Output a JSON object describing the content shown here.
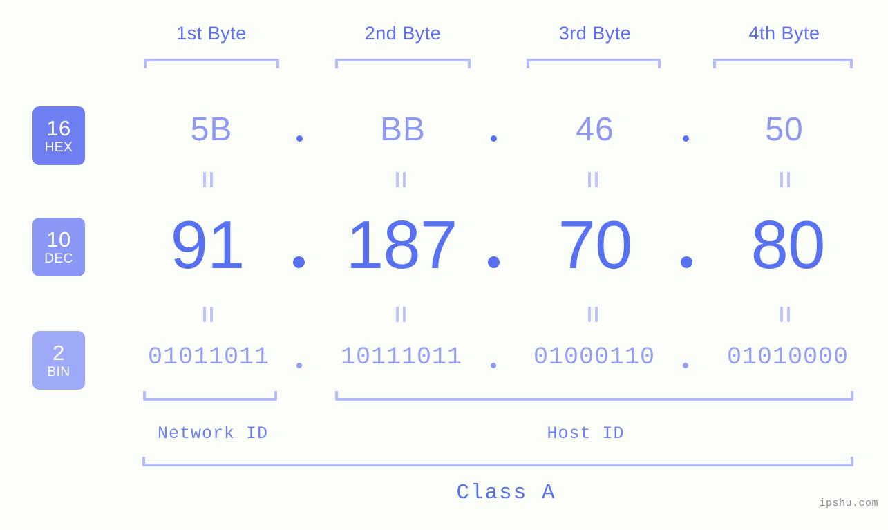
{
  "background_color": "#fcfefa",
  "accent_colors": {
    "hex_badge": "#6f7ef0",
    "dec_badge": "#8a97f4",
    "bin_badge": "#9eaaf7",
    "hex_text": "#8d99f2",
    "dec_text": "#5771f0",
    "bin_text": "#93a0f4",
    "bracket": "#b4bdfa",
    "header_text": "#5b6ef5"
  },
  "byte_headers": [
    {
      "label": "1st Byte"
    },
    {
      "label": "2nd Byte"
    },
    {
      "label": "3rd Byte"
    },
    {
      "label": "4th Byte"
    }
  ],
  "rows": {
    "hex": {
      "badge_number": "16",
      "badge_system": "HEX",
      "values": [
        "5B",
        "BB",
        "46",
        "50"
      ],
      "separator": "."
    },
    "dec": {
      "badge_number": "10",
      "badge_system": "DEC",
      "values": [
        "91",
        "187",
        "70",
        "80"
      ],
      "separator": "."
    },
    "bin": {
      "badge_number": "2",
      "badge_system": "BIN",
      "values": [
        "01011011",
        "10111011",
        "01000110",
        "01010000"
      ],
      "separator": "."
    }
  },
  "equals_mark": "||",
  "sections": {
    "network_id": "Network ID",
    "host_id": "Host ID",
    "class": "Class A"
  },
  "watermark": "ipshu.com"
}
